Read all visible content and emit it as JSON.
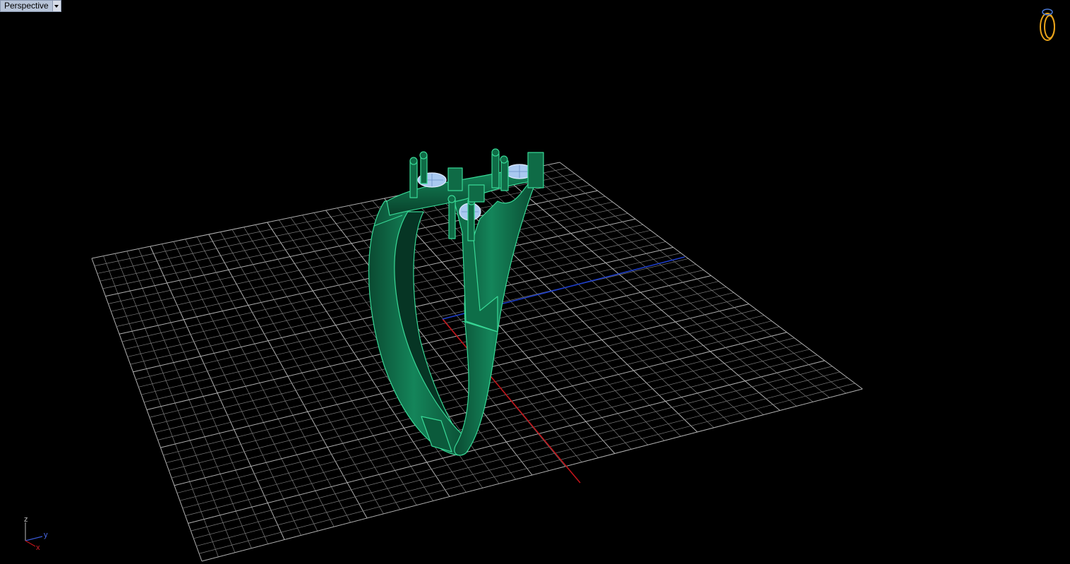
{
  "viewport": {
    "title": "Perspective",
    "menu_icon": "chevron-down-icon"
  },
  "axis_widget": {
    "z": "z",
    "y": "y",
    "x": "x"
  },
  "colors": {
    "background": "#000000",
    "grid": "#8a8a8a",
    "x_axis": "#c0141a",
    "y_axis": "#1e3ec8",
    "ring_metal": "#0f6b46",
    "ring_edge": "#3fe0a0",
    "gem": "#a9c9f0",
    "nav_icon": "#e8a21a"
  },
  "nav_widget": {
    "icon": "ring-navigator-icon"
  }
}
